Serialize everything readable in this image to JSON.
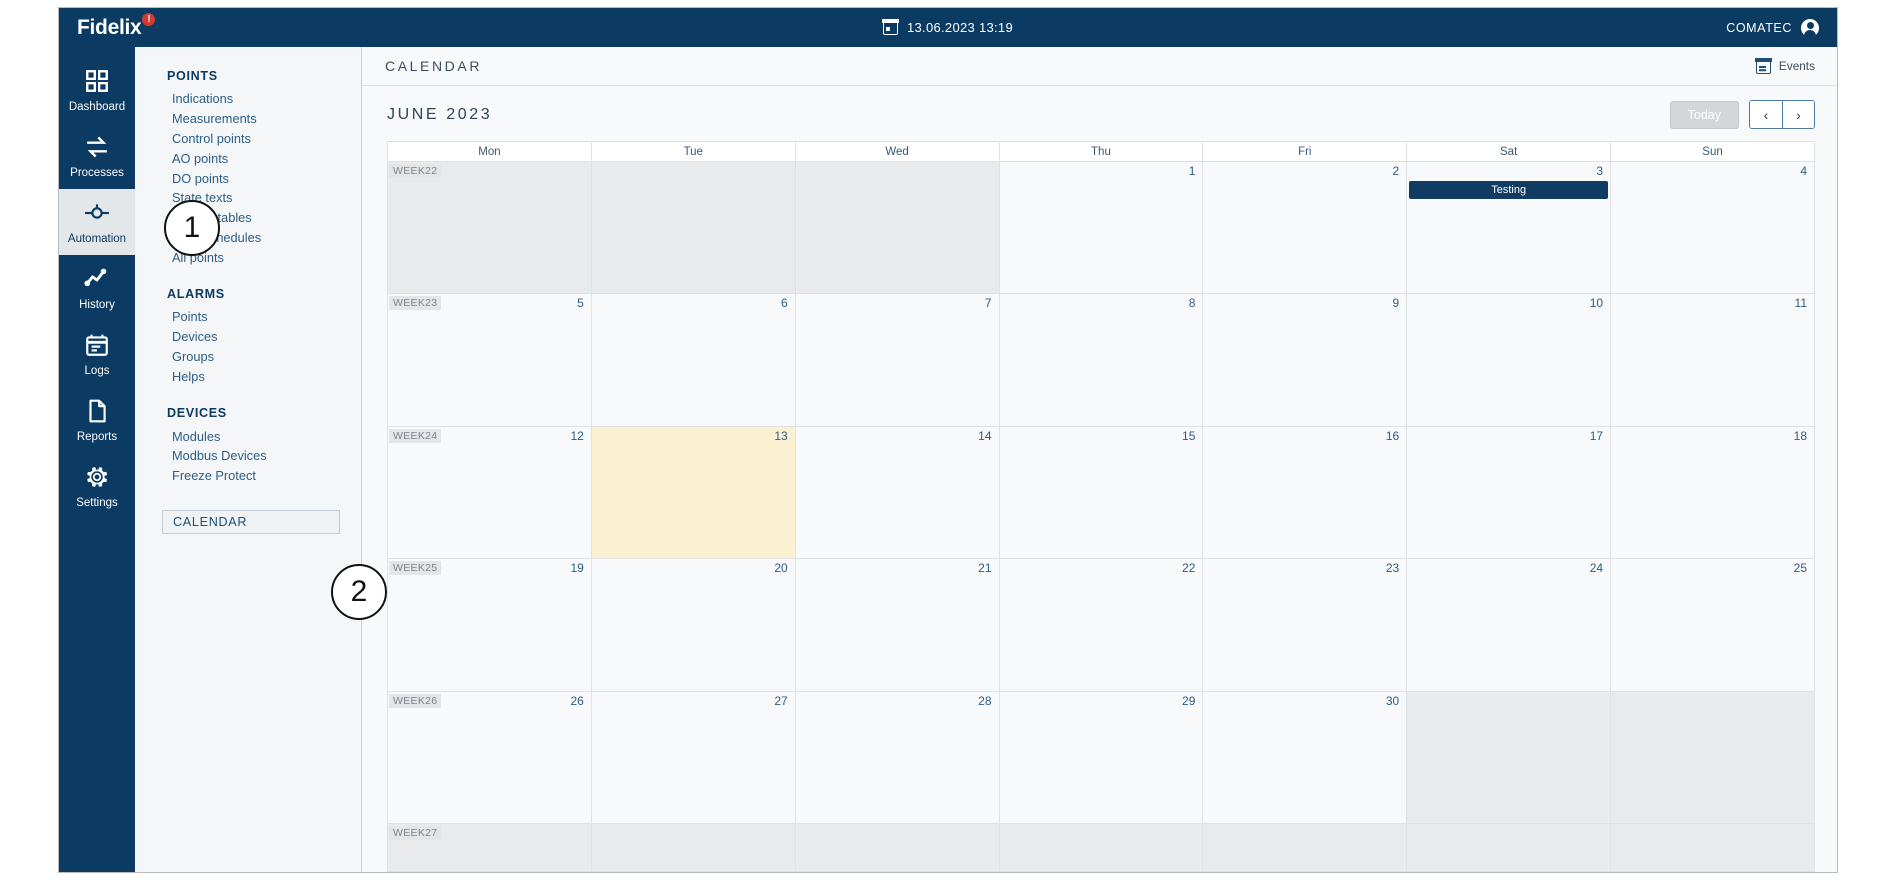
{
  "topbar": {
    "brand": "Fidelix",
    "brand_badge": "!",
    "datetime": "13.06.2023  13:19",
    "datetime_icon": "calendar-icon",
    "user": "COMATEC",
    "user_icon": "user-avatar-icon"
  },
  "rail": {
    "items": [
      {
        "label": "Dashboard",
        "icon": "grid-icon",
        "active": false
      },
      {
        "label": "Processes",
        "icon": "loop-arrows-icon",
        "active": false
      },
      {
        "label": "Automation",
        "icon": "valve-icon",
        "active": true
      },
      {
        "label": "History",
        "icon": "trend-line-icon",
        "active": false
      },
      {
        "label": "Logs",
        "icon": "log-book-icon",
        "active": false
      },
      {
        "label": "Reports",
        "icon": "document-icon",
        "active": false
      },
      {
        "label": "Settings",
        "icon": "gear-icon",
        "active": false
      }
    ]
  },
  "menu": {
    "groups": [
      {
        "title": "POINTS",
        "items": [
          "Indications",
          "Measurements",
          "Control points",
          "AO points",
          "DO points",
          "State texts",
          "Lookup tables",
          "Time schedules",
          "All points"
        ]
      },
      {
        "title": "ALARMS",
        "items": [
          "Points",
          "Devices",
          "Groups",
          "Helps"
        ]
      },
      {
        "title": "DEVICES",
        "items": [
          "Modules",
          "Modbus Devices",
          "Freeze Protect"
        ]
      }
    ],
    "selected": "CALENDAR"
  },
  "content": {
    "page_title": "CALENDAR",
    "events_button": "Events",
    "events_icon": "calendar-icon",
    "month_label": "JUNE 2023",
    "today_button": "Today",
    "prev_button": "‹",
    "next_button": "›",
    "prev_icon": "chevron-left-icon",
    "next_icon": "chevron-right-icon"
  },
  "calendar": {
    "weekday_headers": [
      "Mon",
      "Tue",
      "Wed",
      "Thu",
      "Fri",
      "Sat",
      "Sun"
    ],
    "weeks": [
      {
        "week_label": "WEEK22",
        "days": [
          {
            "num": "",
            "other_month": true,
            "today": false,
            "event": null
          },
          {
            "num": "",
            "other_month": true,
            "today": false,
            "event": null
          },
          {
            "num": "",
            "other_month": true,
            "today": false,
            "event": null
          },
          {
            "num": "1",
            "other_month": false,
            "today": false,
            "event": null
          },
          {
            "num": "2",
            "other_month": false,
            "today": false,
            "event": null
          },
          {
            "num": "3",
            "other_month": false,
            "today": false,
            "event": "Testing"
          },
          {
            "num": "4",
            "other_month": false,
            "today": false,
            "event": null
          }
        ]
      },
      {
        "week_label": "WEEK23",
        "days": [
          {
            "num": "5",
            "other_month": false,
            "today": false,
            "event": null
          },
          {
            "num": "6",
            "other_month": false,
            "today": false,
            "event": null
          },
          {
            "num": "7",
            "other_month": false,
            "today": false,
            "event": null
          },
          {
            "num": "8",
            "other_month": false,
            "today": false,
            "event": null
          },
          {
            "num": "9",
            "other_month": false,
            "today": false,
            "event": null
          },
          {
            "num": "10",
            "other_month": false,
            "today": false,
            "event": null
          },
          {
            "num": "11",
            "other_month": false,
            "today": false,
            "event": null
          }
        ]
      },
      {
        "week_label": "WEEK24",
        "days": [
          {
            "num": "12",
            "other_month": false,
            "today": false,
            "event": null
          },
          {
            "num": "13",
            "other_month": false,
            "today": true,
            "event": null
          },
          {
            "num": "14",
            "other_month": false,
            "today": false,
            "event": null
          },
          {
            "num": "15",
            "other_month": false,
            "today": false,
            "event": null
          },
          {
            "num": "16",
            "other_month": false,
            "today": false,
            "event": null
          },
          {
            "num": "17",
            "other_month": false,
            "today": false,
            "event": null
          },
          {
            "num": "18",
            "other_month": false,
            "today": false,
            "event": null
          }
        ]
      },
      {
        "week_label": "WEEK25",
        "days": [
          {
            "num": "19",
            "other_month": false,
            "today": false,
            "event": null
          },
          {
            "num": "20",
            "other_month": false,
            "today": false,
            "event": null
          },
          {
            "num": "21",
            "other_month": false,
            "today": false,
            "event": null
          },
          {
            "num": "22",
            "other_month": false,
            "today": false,
            "event": null
          },
          {
            "num": "23",
            "other_month": false,
            "today": false,
            "event": null
          },
          {
            "num": "24",
            "other_month": false,
            "today": false,
            "event": null
          },
          {
            "num": "25",
            "other_month": false,
            "today": false,
            "event": null
          }
        ]
      },
      {
        "week_label": "WEEK26",
        "days": [
          {
            "num": "26",
            "other_month": false,
            "today": false,
            "event": null
          },
          {
            "num": "27",
            "other_month": false,
            "today": false,
            "event": null
          },
          {
            "num": "28",
            "other_month": false,
            "today": false,
            "event": null
          },
          {
            "num": "29",
            "other_month": false,
            "today": false,
            "event": null
          },
          {
            "num": "30",
            "other_month": false,
            "today": false,
            "event": null
          },
          {
            "num": "",
            "other_month": true,
            "today": false,
            "event": null
          },
          {
            "num": "",
            "other_month": true,
            "today": false,
            "event": null
          }
        ]
      },
      {
        "week_label": "WEEK27",
        "short": true,
        "days": [
          {
            "num": "",
            "other_month": true,
            "today": false,
            "event": null
          },
          {
            "num": "",
            "other_month": true,
            "today": false,
            "event": null
          },
          {
            "num": "",
            "other_month": true,
            "today": false,
            "event": null
          },
          {
            "num": "",
            "other_month": true,
            "today": false,
            "event": null
          },
          {
            "num": "",
            "other_month": true,
            "today": false,
            "event": null
          },
          {
            "num": "",
            "other_month": true,
            "today": false,
            "event": null
          },
          {
            "num": "",
            "other_month": true,
            "today": false,
            "event": null
          }
        ]
      }
    ]
  },
  "annotations": [
    {
      "id": "1",
      "label": "1"
    },
    {
      "id": "2",
      "label": "2"
    }
  ],
  "colors": {
    "brand_blue": "#0b3a63",
    "accent_link": "#2c5d88",
    "event_blue": "#103c63",
    "today_yellow": "#faf0d2",
    "alarm_red": "#d13a34"
  }
}
